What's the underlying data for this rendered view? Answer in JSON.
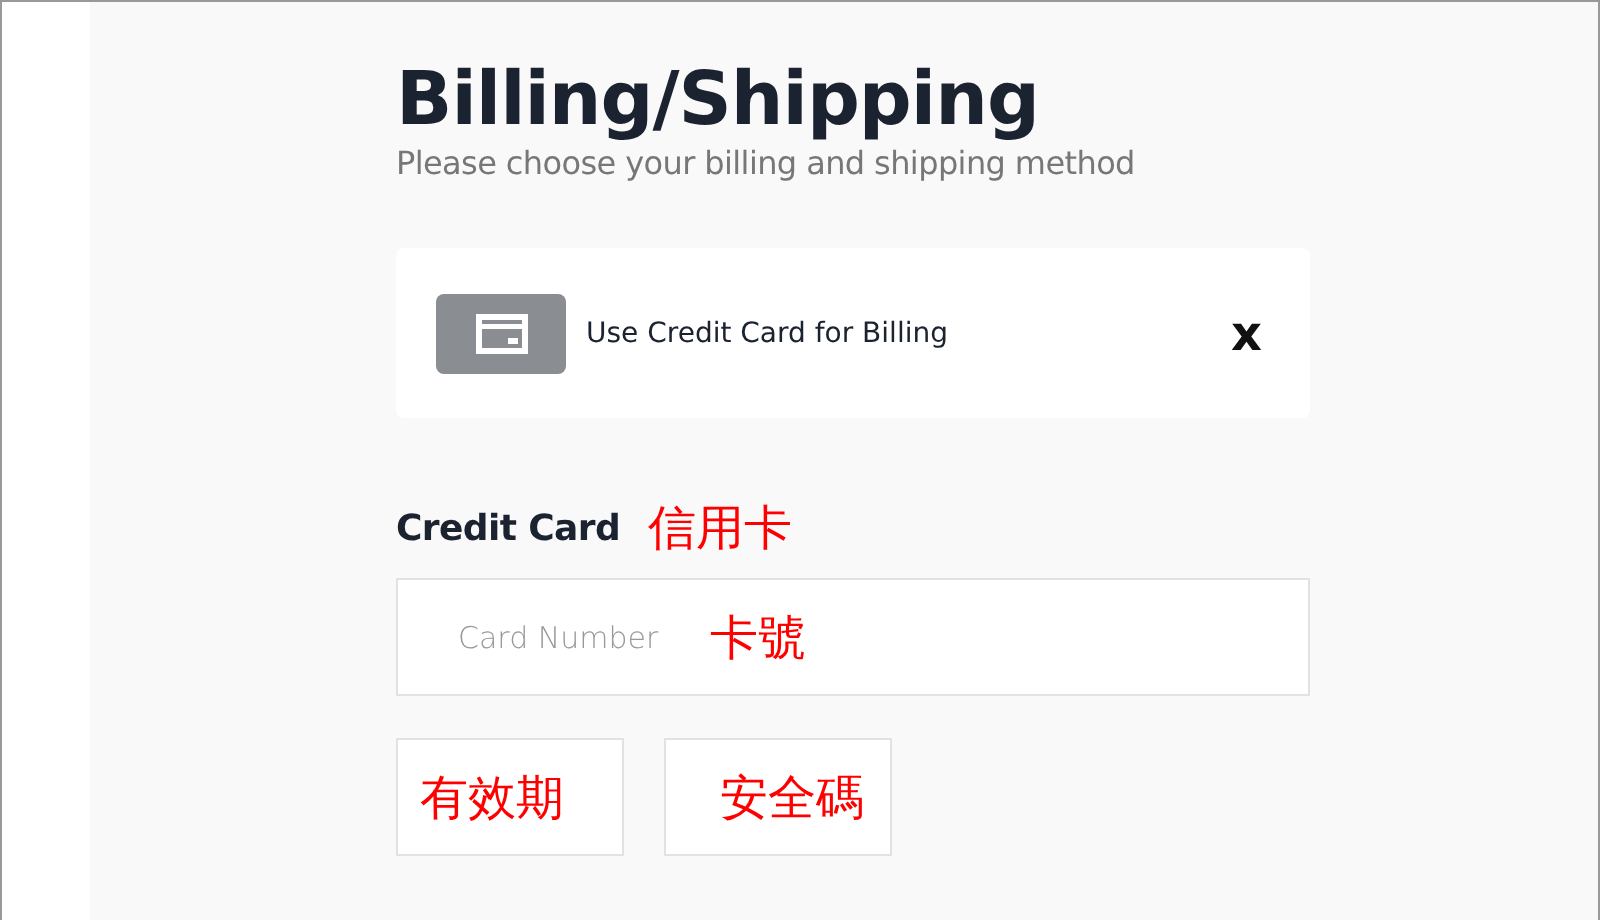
{
  "header": {
    "title": "Billing/Shipping",
    "subtitle": "Please choose your billing and shipping method"
  },
  "billing_option": {
    "label": "Use Credit Card for Billing",
    "close": "x"
  },
  "credit_card": {
    "label": "Credit Card",
    "annotation": "信用卡",
    "card_number": {
      "placeholder": "Card Number",
      "annotation": "卡號"
    },
    "small_fields": [
      {
        "annotation": "有效期"
      },
      {
        "annotation": "安全碼"
      }
    ]
  }
}
